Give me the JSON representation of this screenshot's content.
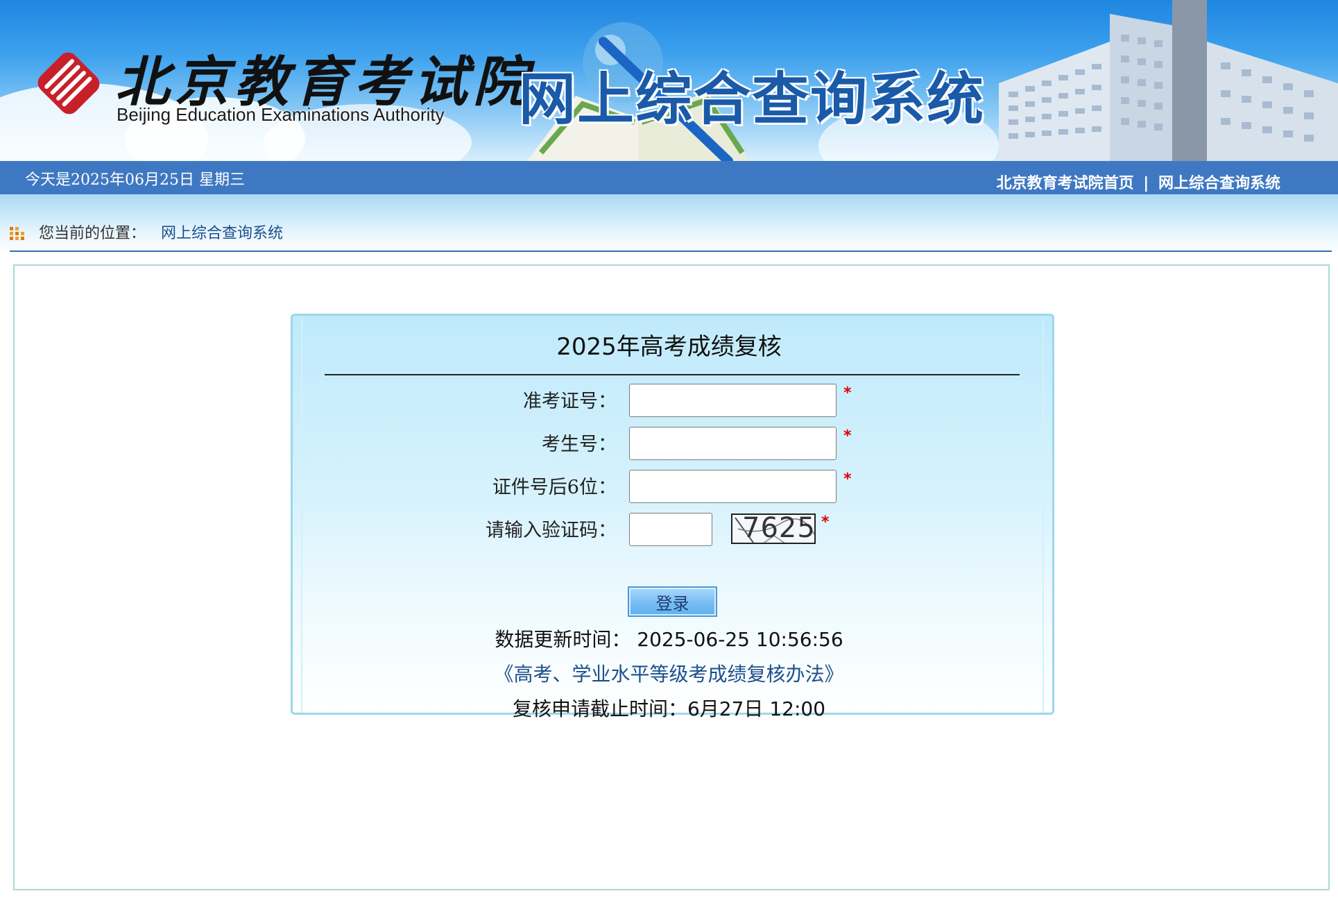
{
  "header": {
    "logo_cn": "北京教育考试院",
    "logo_en": "Beijing Education Examinations Authority",
    "system_title": "网上综合查询系统"
  },
  "navbar": {
    "date_text": "今天是2025年06月25日 星期三",
    "link_home": "北京教育考试院首页",
    "separator": "|",
    "link_system": "网上综合查询系统"
  },
  "breadcrumb": {
    "label": "您当前的位置：",
    "current": "网上综合查询系统"
  },
  "form": {
    "title": "2025年高考成绩复核",
    "fields": [
      {
        "label": "准考证号：",
        "value": "",
        "required": "*"
      },
      {
        "label": "考生号：",
        "value": "",
        "required": "*"
      },
      {
        "label": "证件号后6位：",
        "value": "",
        "required": "*"
      },
      {
        "label": "请输入验证码：",
        "value": "",
        "required": "*"
      }
    ],
    "captcha_text": "7625",
    "login_label": "登录"
  },
  "info": {
    "update_time": "数据更新时间： 2025-06-25 10:56:56",
    "policy_link": "《高考、学业水平等级考成绩复核办法》",
    "deadline": "复核申请截止时间：6月27日 12:00"
  },
  "colors": {
    "navbar": "#3f78c2",
    "title_blue": "#1a5aa8",
    "required": "#e00000",
    "link": "#1d4f8c"
  }
}
